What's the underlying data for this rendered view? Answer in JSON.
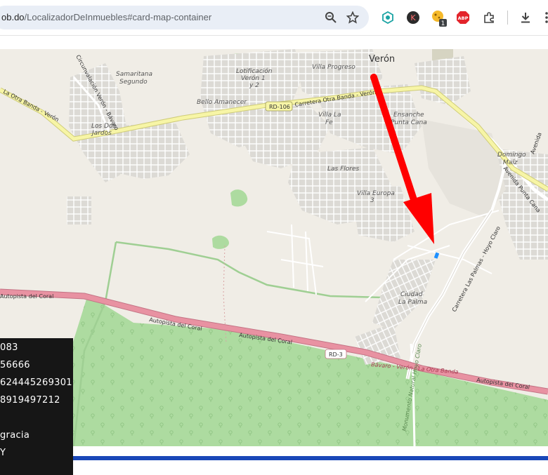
{
  "browser": {
    "url_host": "ob.do",
    "url_path": "/LocalizadorDeInmuebles#card-map-container",
    "extension_badge": "1",
    "abp_label": "ABP",
    "k_label": "K"
  },
  "map": {
    "place_labels": {
      "veron": "Verón",
      "villa_progreso": "Villa Progreso",
      "lotificacion_1": "Lotificación",
      "lotificacion_2": "Verón 1",
      "lotificacion_3": "y 2",
      "samaritana_1": "Samaritana",
      "samaritana_2": "Segundo",
      "bello_amanecer": "Bello Amanecer",
      "los_dos_jardos_1": "Los Dos",
      "los_dos_jardos_2": "Jardos",
      "villa_la_fe_1": "Villa La",
      "villa_la_fe_2": "Fe",
      "ensanche_1": "Ensanche",
      "ensanche_2": "Punta Cana",
      "las_flores": "Las Flores",
      "villa_europa_1": "Villa Europa",
      "villa_europa_2": "3",
      "domingo_maiz_1": "Domingo",
      "domingo_maiz_2": "Maíz",
      "ciudad_la_palma_1": "Ciudad",
      "ciudad_la_palma_2": "La Palma"
    },
    "road_labels": {
      "rd106": "RD-106",
      "rd3": "RD-3",
      "otra_banda_veron": "Carretera Otra Banda - Verón",
      "la_otra_banda_veron": "La Otra Banda - Verón",
      "circunvalacion": "Circunvalación Verón - Bávaro",
      "autopista_1": "Autopista del Coral",
      "autopista_2": "Autopista del Coral",
      "autopista_3": "Autopista del Coral",
      "autopista_4": "Autopista del Coral",
      "avenida_punta_cana": "Avenida Punta Cana",
      "avenida_short": "Avenida",
      "las_palmas": "Carretera Las Palmas - Hoyo Claro",
      "bavaro_veron": "Bávaro - Verón / La Otra Banda",
      "monumento": "Monumento Natural Hoyo Claro"
    },
    "colors": {
      "background": "#f0ede6",
      "green_area": "#addba0",
      "highway": "#e892a2",
      "primary_road": "#f7f5a6",
      "arrow": "#ff0000",
      "marker": "#1e90ff"
    }
  },
  "panel": {
    "lines": [
      "083",
      "56666",
      "624445269301",
      "8919497212",
      "",
      "gracia",
      "Y"
    ]
  }
}
